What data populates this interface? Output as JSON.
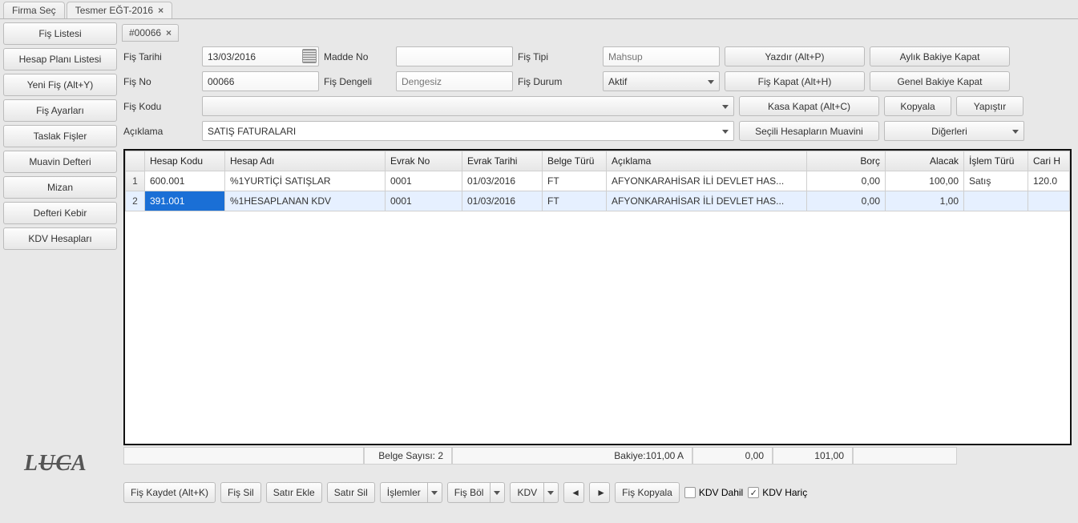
{
  "topTabs": {
    "firmaSec": "Firma Seç",
    "tesmer": "Tesmer EĞT-2016"
  },
  "leftNav": {
    "fisListesi": "Fiş Listesi",
    "hesapPlaniListesi": "Hesap Planı Listesi",
    "yeniFis": "Yeni Fiş (Alt+Y)",
    "fisAyarlari": "Fiş Ayarları",
    "taslakFisler": "Taslak Fişler",
    "muavinDefteri": "Muavin Defteri",
    "mizan": "Mizan",
    "defteriKebir": "Defteri Kebir",
    "kdvHesaplari": "KDV Hesapları"
  },
  "microTabs": {
    "t0": "#00066"
  },
  "form": {
    "labels": {
      "fisTarihi": "Fiş Tarihi",
      "maddeNo": "Madde No",
      "fisTipi": "Fiş Tipi",
      "fisNo": "Fiş No",
      "fisDengeli": "Fiş Dengeli",
      "fisDurum": "Fiş Durum",
      "fisKodu": "Fiş Kodu",
      "aciklama": "Açıklama"
    },
    "values": {
      "fisTarihi": "13/03/2016",
      "maddeNo": "",
      "fisTipiPh": "Mahsup",
      "fisNo": "00066",
      "fisDengeliPh": "Dengesiz",
      "fisDurum": "Aktif",
      "fisKodu": "",
      "aciklama": "SATIŞ FATURALARI"
    },
    "buttons": {
      "yazdir": "Yazdır (Alt+P)",
      "aylikBakiyeKapat": "Aylık Bakiye Kapat",
      "fisKapat": "Fiş Kapat (Alt+H)",
      "genelBakiyeKapat": "Genel Bakiye Kapat",
      "kasaKapat": "Kasa Kapat (Alt+C)",
      "kopyala": "Kopyala",
      "yapistir": "Yapıştır",
      "seciliMuavin": "Seçili Hesapların Muavini",
      "digerleri": "Diğerleri"
    }
  },
  "grid": {
    "headers": {
      "num": "",
      "hesapKodu": "Hesap Kodu",
      "hesapAdi": "Hesap Adı",
      "evrakNo": "Evrak No",
      "evrakTarihi": "Evrak Tarihi",
      "belgeTuru": "Belge Türü",
      "aciklama": "Açıklama",
      "borc": "Borç",
      "alacak": "Alacak",
      "islemTuru": "İşlem Türü",
      "cariH": "Cari H"
    },
    "rows": [
      {
        "n": "1",
        "hesapKodu": "600.001",
        "hesapAdi": "%1YURTİÇİ SATIŞLAR",
        "evrakNo": "0001",
        "evrakTarihi": "01/03/2016",
        "belgeTuru": "FT",
        "aciklama": "AFYONKARAHİSAR İLİ DEVLET HAS...",
        "borc": "0,00",
        "alacak": "100,00",
        "islemTuru": "Satış",
        "cariH": "120.0"
      },
      {
        "n": "2",
        "hesapKodu": "391.001",
        "hesapAdi": "%1HESAPLANAN KDV",
        "evrakNo": "0001",
        "evrakTarihi": "01/03/2016",
        "belgeTuru": "FT",
        "aciklama": "AFYONKARAHİSAR İLİ DEVLET HAS...",
        "borc": "0,00",
        "alacak": "1,00",
        "islemTuru": "",
        "cariH": ""
      }
    ]
  },
  "status": {
    "belgeSayisi": "Belge Sayısı: 2",
    "bakiye": "Bakiye:101,00 A",
    "borcTotal": "0,00",
    "alacakTotal": "101,00"
  },
  "bottom": {
    "fisKaydet": "Fiş Kaydet (Alt+K)",
    "fisSil": "Fiş Sil",
    "satirEkle": "Satır Ekle",
    "satirSil": "Satır Sil",
    "islemler": "İşlemler",
    "fisBol": "Fiş Böl",
    "kdv": "KDV",
    "prev": "◄",
    "next": "►",
    "fisKopyala": "Fiş Kopyala",
    "kdvDahil": "KDV Dahil",
    "kdvHaric": "KDV Hariç"
  },
  "logo": "LUCA"
}
